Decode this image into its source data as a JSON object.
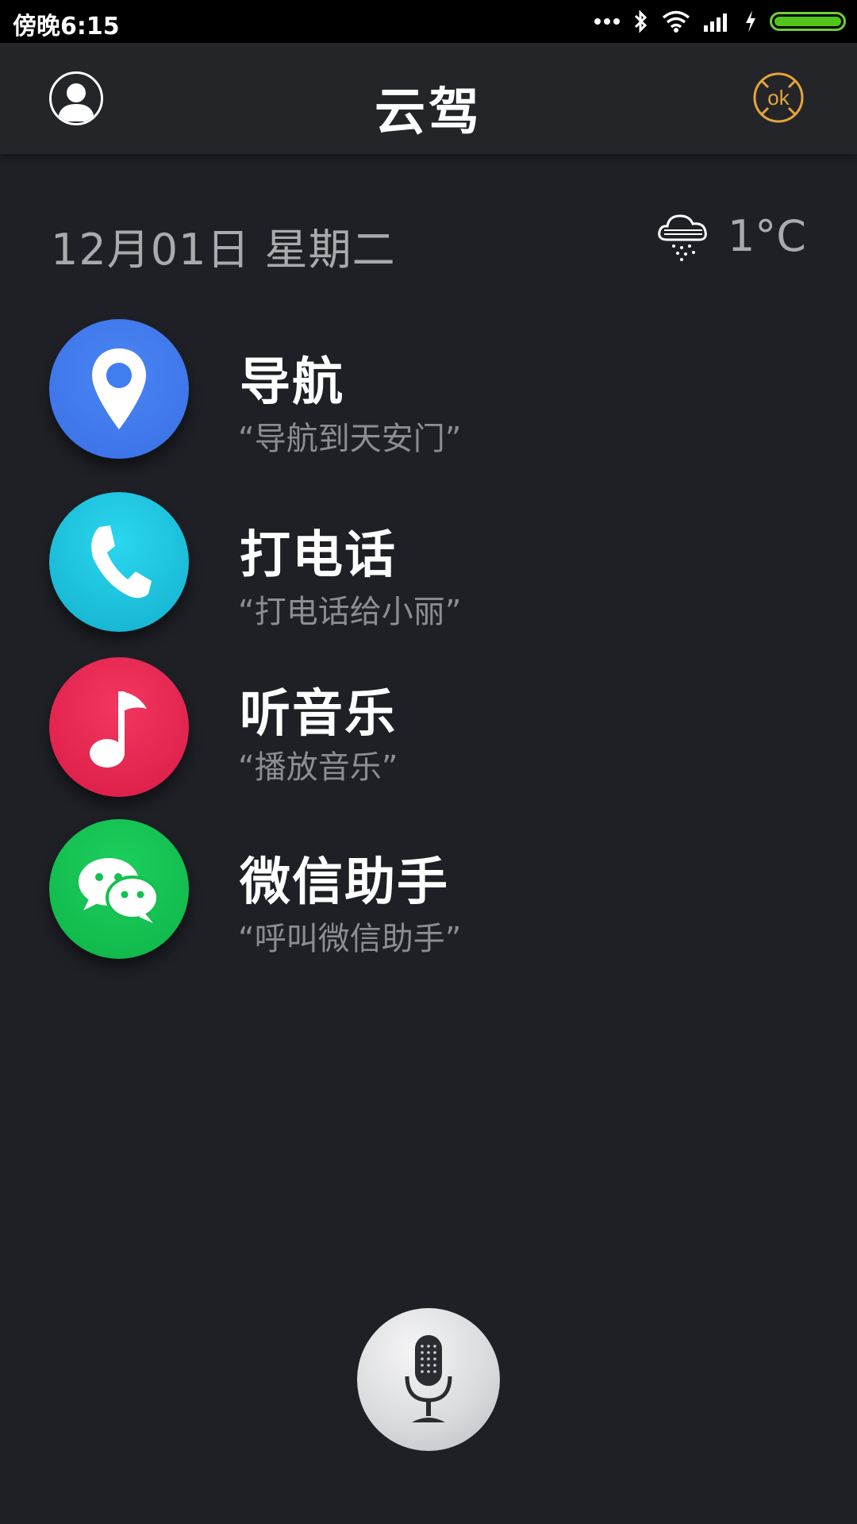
{
  "status_bar": {
    "time": "傍晚6:15"
  },
  "header": {
    "title": "云驾"
  },
  "date_row": {
    "date": "12月01日  星期二",
    "temperature": "1°C"
  },
  "items": [
    {
      "title": "导航",
      "hint": "“导航到天安门”",
      "color": "#3f7df0"
    },
    {
      "title": "打电话",
      "hint": "“打电话给小丽”",
      "color": "#1fbcd8"
    },
    {
      "title": "听音乐",
      "hint": "“播放音乐”",
      "color": "#e8264f"
    },
    {
      "title": "微信助手",
      "hint": "“呼叫微信助手”",
      "color": "#14c04f"
    }
  ],
  "colors": {
    "background": "#1e2026",
    "header": "#232529",
    "ok_accent": "#e8a43a"
  },
  "icons": {
    "avatar": "person-avatar-icon",
    "ok": "ok-button-icon",
    "weather": "snow-cloud-icon",
    "navigation": "map-pin-icon",
    "phone": "phone-icon",
    "music": "music-note-icon",
    "wechat": "wechat-icon",
    "mic": "microphone-icon"
  }
}
